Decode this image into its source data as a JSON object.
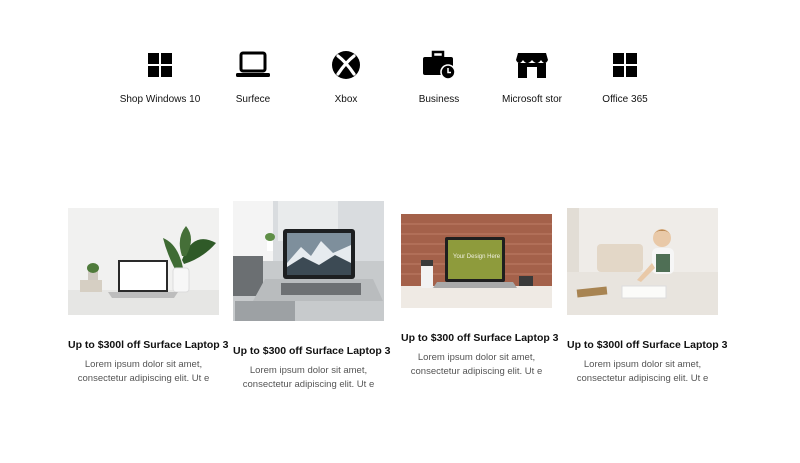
{
  "nav": {
    "items": [
      {
        "label": "Shop Windows 10",
        "icon": "windows-logo-icon"
      },
      {
        "label": "Surfece",
        "icon": "laptop-icon"
      },
      {
        "label": "Xbox",
        "icon": "xbox-logo-icon"
      },
      {
        "label": "Business",
        "icon": "briefcase-clock-icon"
      },
      {
        "label": "Microsoft stor",
        "icon": "store-icon"
      },
      {
        "label": "Office 365",
        "icon": "windows-logo-icon"
      }
    ]
  },
  "cards": [
    {
      "title": "Up to $300l off Surface Laptop 3",
      "description": "Lorem ipsum dolor sit amet, consectetur adipiscing elit. Ut e",
      "image": "laptop-on-desk-with-plant-photo"
    },
    {
      "title": "Up to $300 off Surface Laptop 3",
      "description": "Lorem ipsum dolor sit amet, consectetur adipiscing elit. Ut e",
      "image": "laptop-mountain-wallpaper-photo"
    },
    {
      "title": "Up to $300 off Surface Laptop 3",
      "description": "Lorem ipsum dolor sit amet, consectetur adipiscing elit. Ut e",
      "image": "laptop-brick-wall-photo",
      "screen_text": "Your Design Here"
    },
    {
      "title": "Up to $300l off Surface Laptop 3",
      "description": "Lorem ipsum dolor sit amet, consectetur adipiscing elit. Ut e",
      "image": "girl-studying-at-table-photo"
    }
  ]
}
